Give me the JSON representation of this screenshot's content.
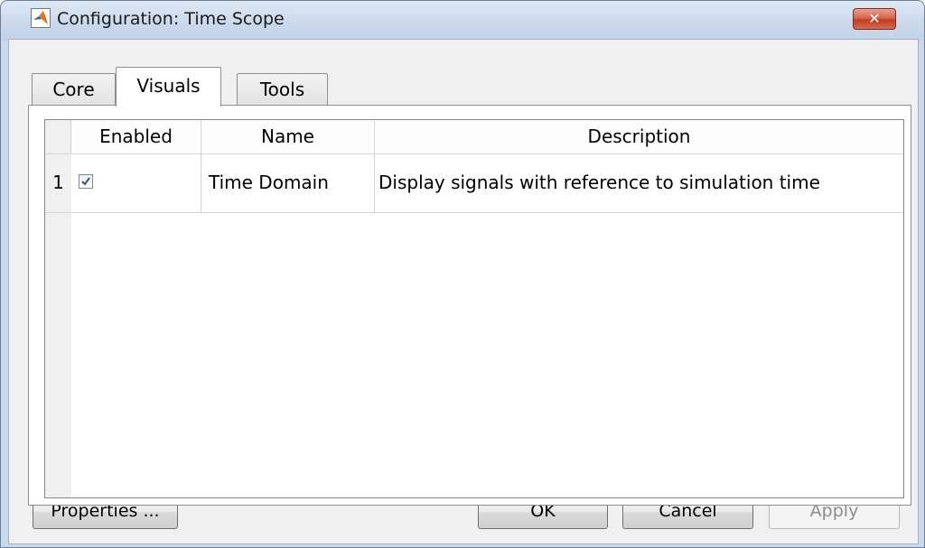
{
  "window": {
    "title": "Configuration: Time Scope",
    "close_glyph": "✕",
    "icon": "matlab-icon"
  },
  "tabs": [
    {
      "label": "Core",
      "active": false
    },
    {
      "label": "Visuals",
      "active": true
    },
    {
      "label": "Tools",
      "active": false
    }
  ],
  "table": {
    "columns": [
      "Enabled",
      "Name",
      "Description"
    ],
    "rows": [
      {
        "index": "1",
        "enabled": true,
        "name": "Time Domain",
        "description": "Display signals with reference to simulation time"
      }
    ]
  },
  "buttons": {
    "properties": "Properties ...",
    "ok": "OK",
    "cancel": "Cancel",
    "apply": "Apply"
  },
  "colors": {
    "titlebar": "#c9d8ea",
    "close_button": "#c33b1e",
    "dialog_bg": "#f0f0f0"
  }
}
